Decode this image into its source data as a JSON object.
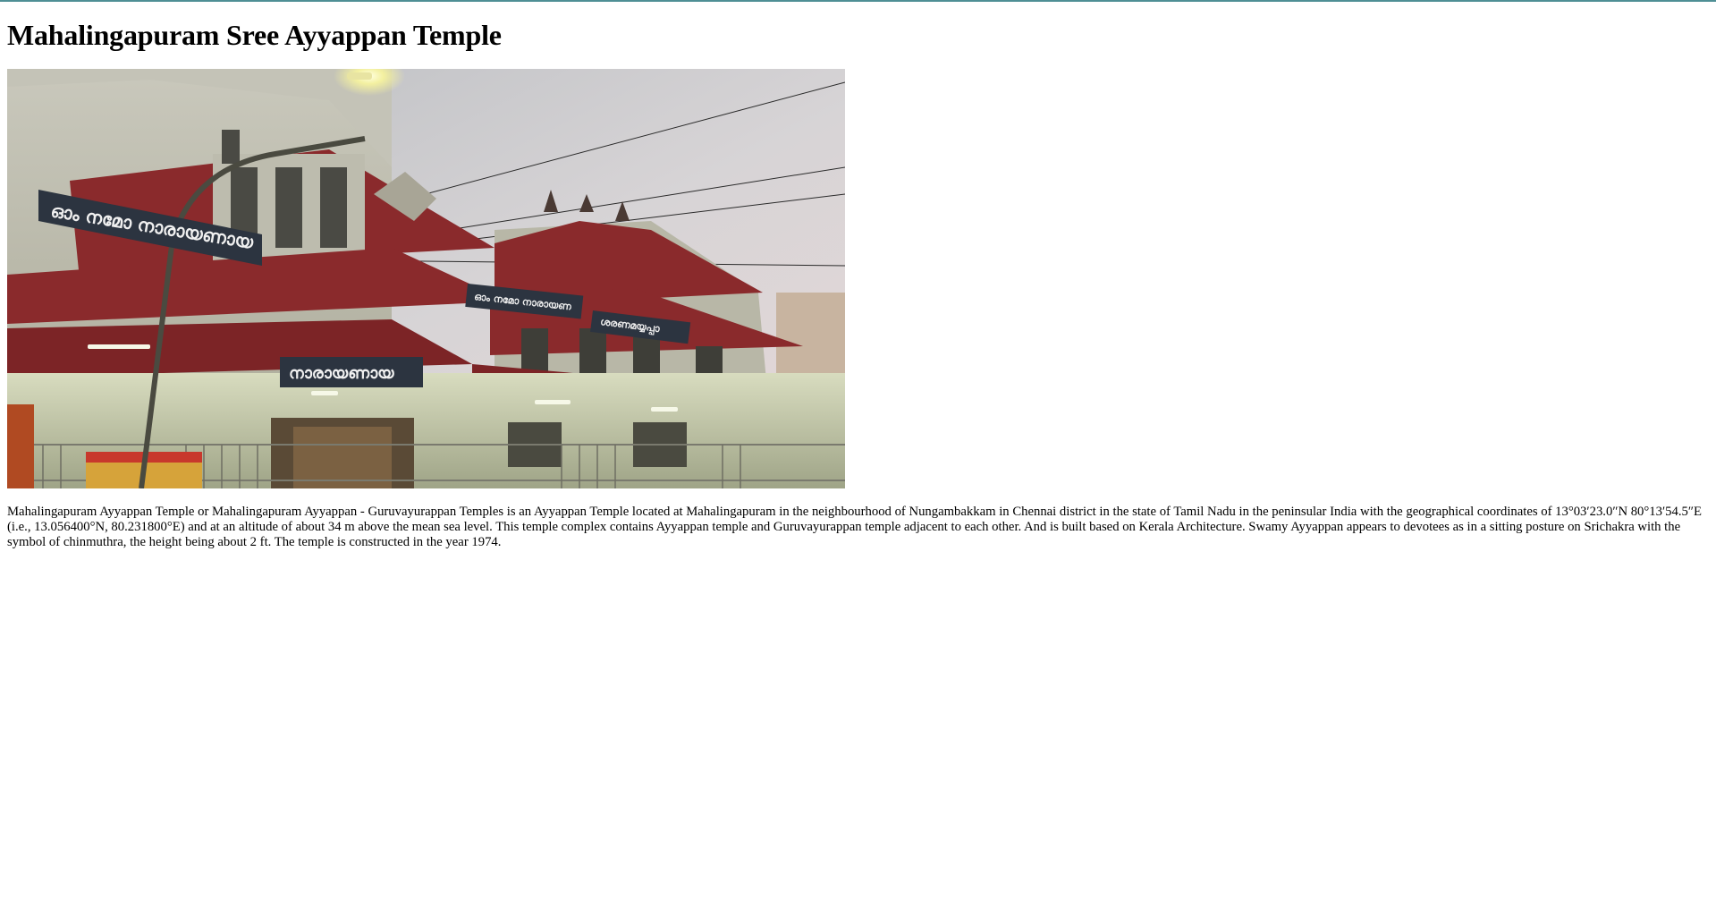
{
  "page": {
    "title": "Mahalingapuram Sree Ayyappan Temple",
    "image_alt": "Mahalingapuram Sree Ayyappan Temple",
    "description": "Mahalingapuram Ayyappan Temple or Mahalingapuram Ayyappan - Guruvayurappan Temples is an Ayyappan Temple located at Mahalingapuram in the neighbourhood of Nungambakkam in Chennai district in the state of Tamil Nadu in the peninsular India with the geographical coordinates of 13°03′23.0″N 80°13′54.5″E (i.e., 13.056400°N, 80.231800°E) and at an altitude of about 34 m above the mean sea level. This temple complex contains Ayyappan temple and Guruvayurappan temple adjacent to each other. And is built based on Kerala Architecture. Swamy Ayyappan appears to devotees as in a sitting posture on Srichakra with the symbol of chinmuthra, the height being about 2 ft. The temple is constructed in the year 1974."
  },
  "photo_signs": {
    "sign_left": "ഓം നമോ നാരായണായ",
    "sign_center": "നാരായണായ",
    "sign_mid": "ഓം നമോ നാരായണ",
    "sign_right": "ശരണമയ്യപ്പാ"
  },
  "colors": {
    "top_rule": "#4f8f95",
    "roof_red": "#8a2a2c",
    "wall_cream": "#d9d8c4",
    "sky": "#c9cdd2"
  }
}
